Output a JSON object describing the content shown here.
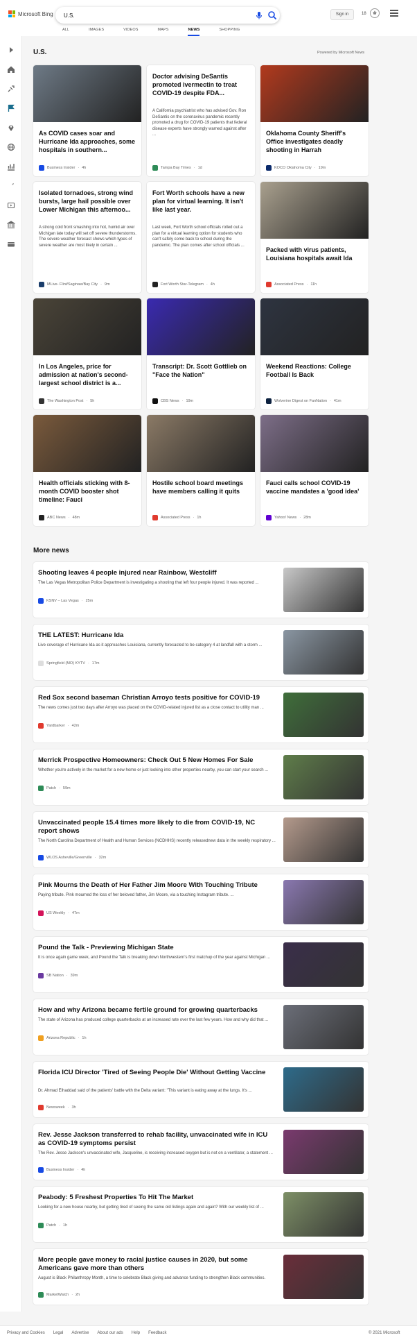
{
  "header": {
    "logo_text": "Microsoft Bing",
    "search_value": "U.S.",
    "signin_label": "Sign in",
    "rewards_count": "18",
    "tabs": [
      {
        "label": "ALL",
        "active": false
      },
      {
        "label": "IMAGES",
        "active": false
      },
      {
        "label": "VIDEOS",
        "active": false
      },
      {
        "label": "MAPS",
        "active": false
      },
      {
        "label": "NEWS",
        "active": true
      },
      {
        "label": "SHOPPING",
        "active": false
      }
    ]
  },
  "sidebar": {
    "icons": [
      "expand-icon",
      "home-icon",
      "discover-icon",
      "flag-icon",
      "location-icon",
      "world-icon",
      "business-icon",
      "science-icon",
      "entertainment-icon",
      "politics-icon",
      "money-icon"
    ]
  },
  "section": {
    "title": "U.S.",
    "powered_by": "Powered by Microsoft News"
  },
  "cards": [
    {
      "title": "As COVID cases soar and Hurricane Ida approaches, some hospitals in southern...",
      "snippet": "",
      "source": "Business Insider",
      "time": "4h",
      "has_image": true,
      "image_color": "#6e7a86",
      "src_color": "#174ae4"
    },
    {
      "title": "Doctor advising DeSantis promoted ivermectin to treat COVID-19 despite FDA...",
      "snippet": "A California psychiatrist who has advised Gov. Ron DeSantis on the coronavirus pandemic recently promoted a drug for COVID-19 patients that federal disease experts have strongly warned against after ...",
      "source": "Tampa Bay Times",
      "time": "1d",
      "has_image": false,
      "image_color": "",
      "src_color": "#2e8b57"
    },
    {
      "title": "Oklahoma County Sheriff's Office investigates deadly shooting in Harrah",
      "snippet": "",
      "source": "KOCO Oklahoma City",
      "time": "19m",
      "has_image": true,
      "image_color": "#b23a1e",
      "src_color": "#0b2a6b"
    },
    {
      "title": "Isolated tornadoes, strong wind bursts, large hail possible over Lower Michigan this afternoo...",
      "snippet": "A strong cold front smashing into hot, humid air over Michigan late today will set off severe thunderstorms. The severe weather forecast shows which types of severe weather are most likely in certain ...",
      "source": "MLive- Flint/Saginaw/Bay City",
      "time": "9m",
      "has_image": false,
      "image_color": "",
      "src_color": "#1a3d6b"
    },
    {
      "title": "Fort Worth schools have a new plan for virtual learning. It isn't like last year.",
      "snippet": "Last week, Fort Worth school officials rolled out a plan for a virtual learning option for students who can't safely come back to school during the pandemic. The plan comes after school officials ...",
      "source": "Fort Worth Star-Telegram",
      "time": "4h",
      "has_image": false,
      "image_color": "",
      "src_color": "#222222"
    },
    {
      "title": "Packed with virus patients, Louisiana hospitals await Ida",
      "snippet": "",
      "source": "Associated Press",
      "time": "11h",
      "has_image": true,
      "image_color": "#a9a08e",
      "src_color": "#e03a2e"
    },
    {
      "title": "In Los Angeles, price for admission at nation's second-largest school district is a...",
      "snippet": "",
      "source": "The Washington Post",
      "time": "5h",
      "has_image": true,
      "image_color": "#4a4438",
      "src_color": "#333333"
    },
    {
      "title": "Transcript: Dr. Scott Gottlieb on \"Face the Nation\"",
      "snippet": "",
      "source": "CBS News",
      "time": "19m",
      "has_image": true,
      "image_color": "#3a2ab0",
      "src_color": "#111111"
    },
    {
      "title": "Weekend Reactions: College Football Is Back",
      "snippet": "",
      "source": "Wolverine Digest on FanNation",
      "time": "41m",
      "has_image": true,
      "image_color": "#2e3440",
      "src_color": "#0d2240"
    },
    {
      "title": "Health officials sticking with 8-month COVID booster shot timeline: Fauci",
      "snippet": "",
      "source": "ABC News",
      "time": "48m",
      "has_image": true,
      "image_color": "#7a5a3c",
      "src_color": "#222222"
    },
    {
      "title": "Hostile school board meetings have members calling it quits",
      "snippet": "",
      "source": "Associated Press",
      "time": "1h",
      "has_image": true,
      "image_color": "#8b7a66",
      "src_color": "#e03a2e"
    },
    {
      "title": "Fauci calls school COVID-19 vaccine mandates a 'good idea'",
      "snippet": "",
      "source": "Yahoo! News",
      "time": "28m",
      "has_image": true,
      "image_color": "#7d6e88",
      "src_color": "#6001d2"
    }
  ],
  "more_news": {
    "title": "More news",
    "items": [
      {
        "title": "Shooting leaves 4 people injured near Rainbow, Westcliff",
        "snippet": "The Las Vegas Metropolitan Police Department is investigating a shooting that left four people injured. It was reported ...",
        "source": "KSNV – Las Vegas",
        "time": "25m",
        "image_color": "#c8c8c8",
        "src_color": "#174ae4"
      },
      {
        "title": "THE LATEST: Hurricane Ida",
        "snippet": "Live coverage of Hurricane Ida as it approaches Louisiana, currently forecasted to be category 4 at landfall with a storm ...",
        "source": "Springfield (MO) KYTV",
        "time": "17m",
        "image_color": "#8a96a2",
        "src_color": "#dddddd"
      },
      {
        "title": "Red Sox second baseman Christian Arroyo tests positive for COVID-19",
        "snippet": "The news comes just two days after Arroyo was placed on the COVID-related injured list as a close contact to utility man ...",
        "source": "Yardbarker",
        "time": "42m",
        "image_color": "#3f6e3a",
        "src_color": "#e03a2e"
      },
      {
        "title": "Merrick Prospective Homeowners: Check Out 5 New Homes For Sale",
        "snippet": "Whether you're actively in the market for a new home or just looking into other properties nearby, you can start your search ...",
        "source": "Patch",
        "time": "59m",
        "image_color": "#5f7d4a",
        "src_color": "#2e8b57"
      },
      {
        "title": "Unvaccinated people 15.4 times more likely to die from COVID-19, NC report shows",
        "snippet": "The North Carolina Department of Health and Human Services (NCDHHS) recently releasednew data in the weekly respiratory ...",
        "source": "WLOS Asheville/Greenville",
        "time": "32m",
        "image_color": "#b49a8c",
        "src_color": "#174ae4"
      },
      {
        "title": "Pink Mourns the Death of Her Father Jim Moore With Touching Tribute",
        "snippet": "Paying tribute. Pink mourned the loss of her beloved father, Jim Moore, via a touching Instagram tribute. ...",
        "source": "US Weekly",
        "time": "47m",
        "image_color": "#8a78b0",
        "src_color": "#d4145a"
      },
      {
        "title": "Pound the Talk - Previewing Michigan State",
        "snippet": "It is once again game week, and Pound the Talk is breaking down Northwestern's first matchup of the year against Michigan ...",
        "source": "SB Nation",
        "time": "39m",
        "image_color": "#3a2e4a",
        "src_color": "#6a3aa0"
      },
      {
        "title": "How and why Arizona became fertile ground for growing quarterbacks",
        "snippet": "The state of Arizona has produced college quarterbacks at an increased rate over the last few years. How and why did that ...",
        "source": "Arizona Republic",
        "time": "1h",
        "image_color": "#6b6e78",
        "src_color": "#f0a020"
      },
      {
        "title": "Florida ICU Director 'Tired of Seeing People Die' Without Getting Vaccine",
        "snippet": "Dr. Ahmad Elhaddad said of the patients' battle with the Delta variant: \"This variant is eating away at the lungs. It's ...",
        "source": "Newsweek",
        "time": "3h",
        "image_color": "#2e6b8a",
        "src_color": "#e03a2e"
      },
      {
        "title": "Rev. Jesse Jackson transferred to rehab facility, unvaccinated wife in ICU as COVID-19 symptoms persist",
        "snippet": "The Rev. Jesse Jackson's unvaccinated wife, Jacqueline, is receiving increased oxygen but is not on a ventilator, a statement ...",
        "source": "Business Insider",
        "time": "4h",
        "image_color": "#7a3a6e",
        "src_color": "#174ae4"
      },
      {
        "title": "Peabody: 5 Freshest Properties To Hit The Market",
        "snippet": "Looking for a new house nearby, but getting tired of seeing the same old listings again and again? With our weekly list of ...",
        "source": "Patch",
        "time": "1h",
        "image_color": "#7d8f66",
        "src_color": "#2e8b57"
      },
      {
        "title": "More people gave money to racial justice causes in 2020, but some Americans gave more than others",
        "snippet": "August is Black Philanthropy Month, a time to celebrate Black giving and advance funding to strengthen Black communities.",
        "source": "MarketWatch",
        "time": "2h",
        "image_color": "#6a2e3a",
        "src_color": "#2e8b57"
      }
    ]
  },
  "footer": {
    "links": [
      "Privacy and Cookies",
      "Legal",
      "Advertise",
      "About our ads",
      "Help",
      "Feedback"
    ],
    "copyright": "© 2021 Microsoft"
  },
  "colors": {
    "accent": "#174ae4",
    "page_bg": "#f5f5f5"
  }
}
